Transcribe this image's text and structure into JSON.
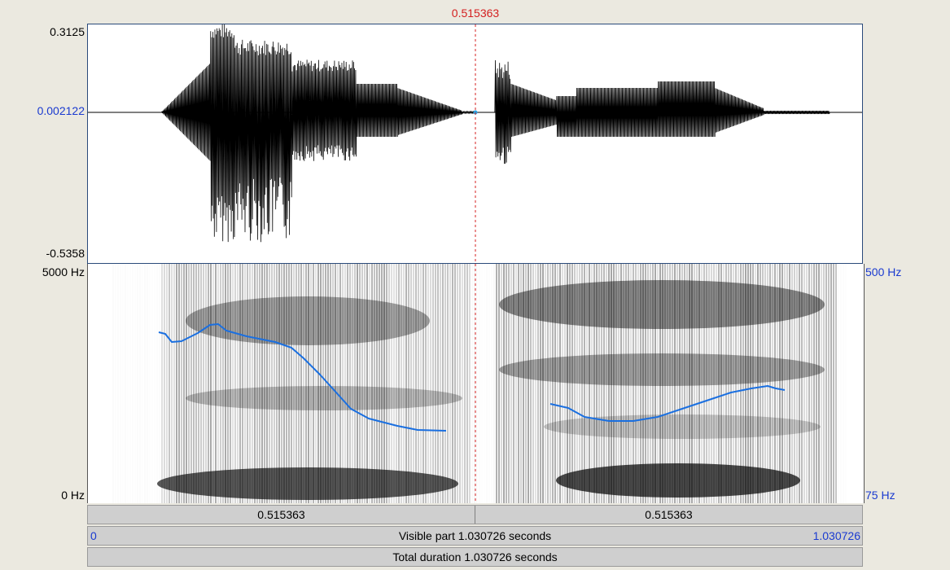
{
  "cursor": {
    "time_label": "0.515363"
  },
  "waveform": {
    "y_max_label": "0.3125",
    "y_center_label": "0.002122",
    "y_min_label": "-0.5358"
  },
  "spectrogram": {
    "freq_top_label": "5000 Hz",
    "freq_bottom_label": "0 Hz",
    "pitch_top_label": "500 Hz",
    "pitch_bottom_label": "75 Hz"
  },
  "selection_bar": {
    "left_duration": "0.515363",
    "right_duration": "0.515363"
  },
  "visible_bar": {
    "start": "0",
    "label": "Visible part 1.030726 seconds",
    "end": "1.030726"
  },
  "total_bar": {
    "label": "Total duration 1.030726 seconds"
  },
  "colors": {
    "cursor": "#d42020",
    "pitch": "#1a6fe0",
    "axis_blue": "#1a3ad0"
  }
}
